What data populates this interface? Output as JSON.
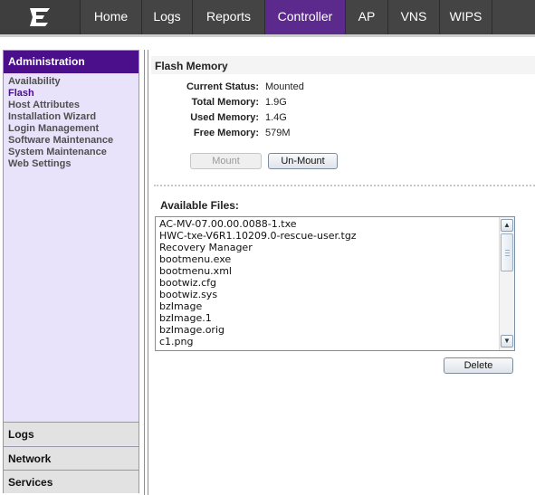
{
  "nav": {
    "logo_icon": "extreme-networks-logo",
    "tabs": [
      {
        "label": "Home"
      },
      {
        "label": "Logs"
      },
      {
        "label": "Reports"
      },
      {
        "label": "Controller",
        "active": true
      },
      {
        "label": "AP"
      },
      {
        "label": "VNS"
      },
      {
        "label": "WIPS"
      }
    ],
    "active_color": "#5b2a8c"
  },
  "sidebar": {
    "header": "Administration",
    "links": [
      {
        "label": "Availability"
      },
      {
        "label": "Flash",
        "active": true
      },
      {
        "label": "Host Attributes"
      },
      {
        "label": "Installation Wizard"
      },
      {
        "label": "Login Management"
      },
      {
        "label": "Software Maintenance"
      },
      {
        "label": "System Maintenance"
      },
      {
        "label": "Web Settings"
      }
    ],
    "sections": [
      {
        "label": "Logs"
      },
      {
        "label": "Network"
      },
      {
        "label": "Services"
      }
    ]
  },
  "main": {
    "title": "Flash Memory",
    "fields": {
      "status_label": "Current Status:",
      "status_value": "Mounted",
      "total_label": "Total Memory:",
      "total_value": "1.9G",
      "used_label": "Used Memory:",
      "used_value": "1.4G",
      "free_label": "Free Memory:",
      "free_value": "579M"
    },
    "mount_button": "Mount",
    "unmount_button": "Un-Mount",
    "files_label": "Available Files:",
    "files": [
      "AC-MV-07.00.00.0088-1.txe",
      "HWC-txe-V6R1.10209.0-rescue-user.tgz",
      "Recovery Manager",
      "bootmenu.exe",
      "bootmenu.xml",
      "bootwiz.cfg",
      "bootwiz.sys",
      "bzImage",
      "bzImage.1",
      "bzImage.orig",
      "c1.png"
    ],
    "delete_button": "Delete"
  }
}
